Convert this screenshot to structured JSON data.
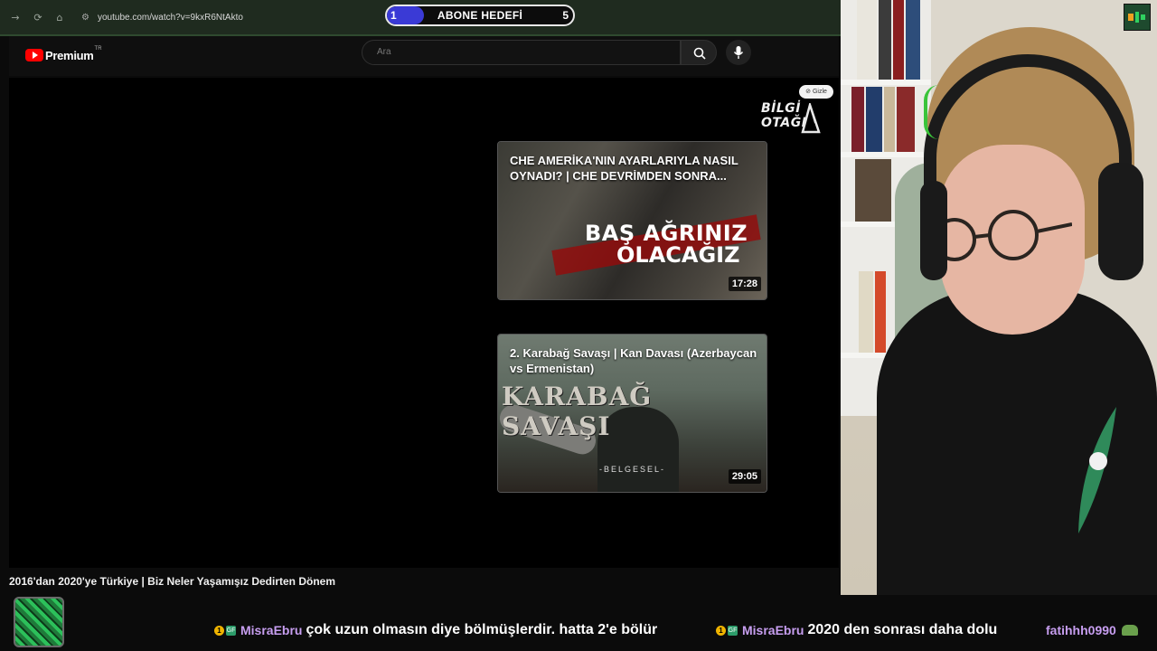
{
  "browser": {
    "url": "youtube.com/watch?v=9kxR6NtAkto",
    "back_icon": "→",
    "reload_icon": "⟳",
    "home_icon": "⌂",
    "site_icon": "⚙"
  },
  "goal_widget": {
    "label": "ABONE HEDEFİ",
    "current": "1",
    "target": "5",
    "progress_fraction": 0.2,
    "fill_color": "#3a3ad6"
  },
  "youtube": {
    "logo_text": "Premium",
    "region_sup": "TR",
    "search_placeholder": "Ara",
    "brand_color": "#ff0000"
  },
  "player": {
    "hide_label": "Gizle",
    "channel_logo_line1": "BİLGİ",
    "channel_logo_line2": "OTAĞI",
    "endcards": [
      {
        "title": "CHE AMERİKA'NIN AYARLARIYLA NASIL OYNADI? | CHE DEVRİMDEN SONRA...",
        "thumb_text_1": "BAŞ AĞRINIZ",
        "thumb_text_2": "OLACAĞIZ",
        "duration": "17:28"
      },
      {
        "title": "2. Karabağ Savaşı | Kan Davası (Azerbaycan vs Ermenistan)",
        "thumb_text_1": "KARABAĞ SAVAŞI",
        "thumb_text_2": "-BELGESEL-",
        "duration": "29:05"
      }
    ]
  },
  "video_title": "2016'dan 2020'ye Türkiye | Biz Neler Yaşamışız Dedirten Dönem",
  "chat_ticker": [
    {
      "user": "MisraEbru",
      "message": "çok uzun olmasın diye bölmüşlerdir. hatta 2'e bölür",
      "coin": "1",
      "badge": "GF"
    },
    {
      "user": "MisraEbru",
      "message": "2020 den sonrası daha dolu",
      "coin": "1",
      "badge": "GF"
    },
    {
      "user": "fatihhh0990",
      "message": "",
      "coin": "",
      "badge": ""
    }
  ]
}
